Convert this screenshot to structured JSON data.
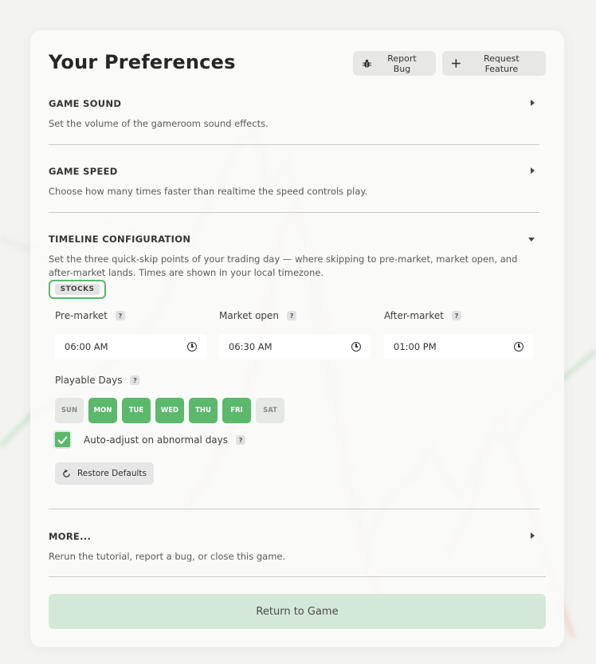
{
  "header": {
    "title": "Your Preferences",
    "report_bug": "Report Bug",
    "request_feature": "Request Feature"
  },
  "sections": {
    "sound": {
      "title": "GAME SOUND",
      "desc": "Set the volume of the gameroom sound effects."
    },
    "speed": {
      "title": "GAME SPEED",
      "desc": "Choose how many times faster than realtime the speed controls play."
    },
    "timeline": {
      "title": "TIMELINE CONFIGURATION",
      "desc": "Set the three quick-skip points of your trading day — where skipping to pre-market, market open, and after-market lands. Times are shown in your local timezone."
    },
    "more": {
      "title": "MORE...",
      "desc": "Rerun the tutorial, report a bug, or close this game."
    }
  },
  "timeline": {
    "tab": "STOCKS",
    "premarket": {
      "label": "Pre-market",
      "value": "06:00 AM"
    },
    "market_open": {
      "label": "Market open",
      "value": "06:30 AM"
    },
    "after_market": {
      "label": "After-market",
      "value": "01:00 PM"
    },
    "help": "?",
    "playable_days_label": "Playable Days",
    "days": [
      {
        "label": "SUN",
        "selected": false
      },
      {
        "label": "MON",
        "selected": true
      },
      {
        "label": "TUE",
        "selected": true
      },
      {
        "label": "WED",
        "selected": true
      },
      {
        "label": "THU",
        "selected": true
      },
      {
        "label": "FRI",
        "selected": true
      },
      {
        "label": "SAT",
        "selected": false
      }
    ],
    "auto_adjust_label": "Auto-adjust on abnormal days",
    "auto_adjust_checked": true,
    "restore_label": "Restore Defaults"
  },
  "footer": {
    "return_label": "Return to Game"
  },
  "colors": {
    "accent": "#5cb86b",
    "return_bg": "#d4e8d7"
  }
}
